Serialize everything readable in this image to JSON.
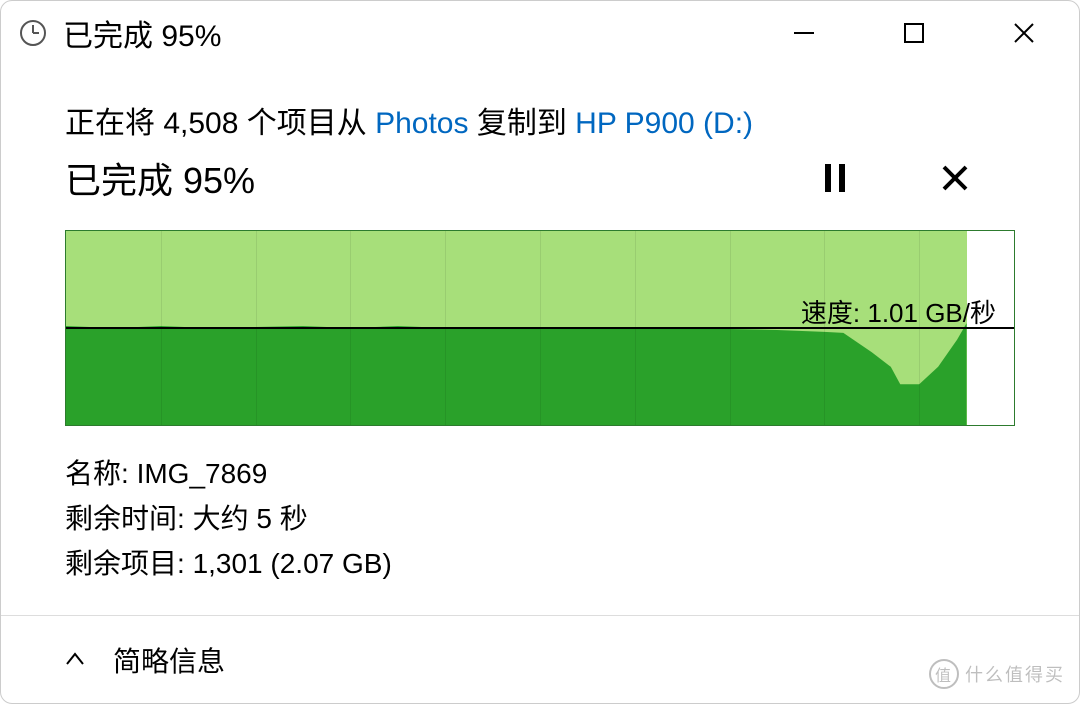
{
  "titlebar": {
    "title": "已完成 95%"
  },
  "copyline": {
    "prefix": "正在将 ",
    "count": "4,508",
    "mid1": " 个项目从 ",
    "source": "Photos",
    "mid2": " 复制到 ",
    "dest": "HP P900 (D:)"
  },
  "progress": {
    "text": "已完成 95%"
  },
  "speed": {
    "label": "速度: 1.01 GB/秒"
  },
  "details": {
    "name_label": "名称: ",
    "name_value": "IMG_7869",
    "time_label": "剩余时间: ",
    "time_value": "大约 5 秒",
    "items_label": "剩余项目: ",
    "items_value": "1,301 (2.07 GB)"
  },
  "footer": {
    "label": "简略信息"
  },
  "watermark": {
    "badge": "值",
    "text": "什么值得买"
  },
  "chart_data": {
    "type": "area",
    "xlabel": "",
    "ylabel": "",
    "title": "",
    "ylim": [
      0,
      2.0
    ],
    "x": [
      0,
      0.05,
      0.1,
      0.15,
      0.2,
      0.25,
      0.3,
      0.35,
      0.4,
      0.45,
      0.5,
      0.55,
      0.6,
      0.65,
      0.7,
      0.75,
      0.8,
      0.82,
      0.85,
      0.87,
      0.88,
      0.9,
      0.92,
      0.94,
      0.95,
      1.0
    ],
    "values": [
      1.02,
      1.0,
      1.02,
      1.0,
      1.01,
      1.02,
      1.0,
      1.02,
      1.0,
      1.01,
      1.01,
      1.0,
      1.01,
      1.0,
      0.99,
      0.98,
      0.96,
      0.95,
      0.75,
      0.6,
      0.42,
      0.42,
      0.6,
      0.88,
      1.05,
      1.05
    ],
    "progress_fraction": 0.95,
    "speed_line_value": 1.01
  }
}
